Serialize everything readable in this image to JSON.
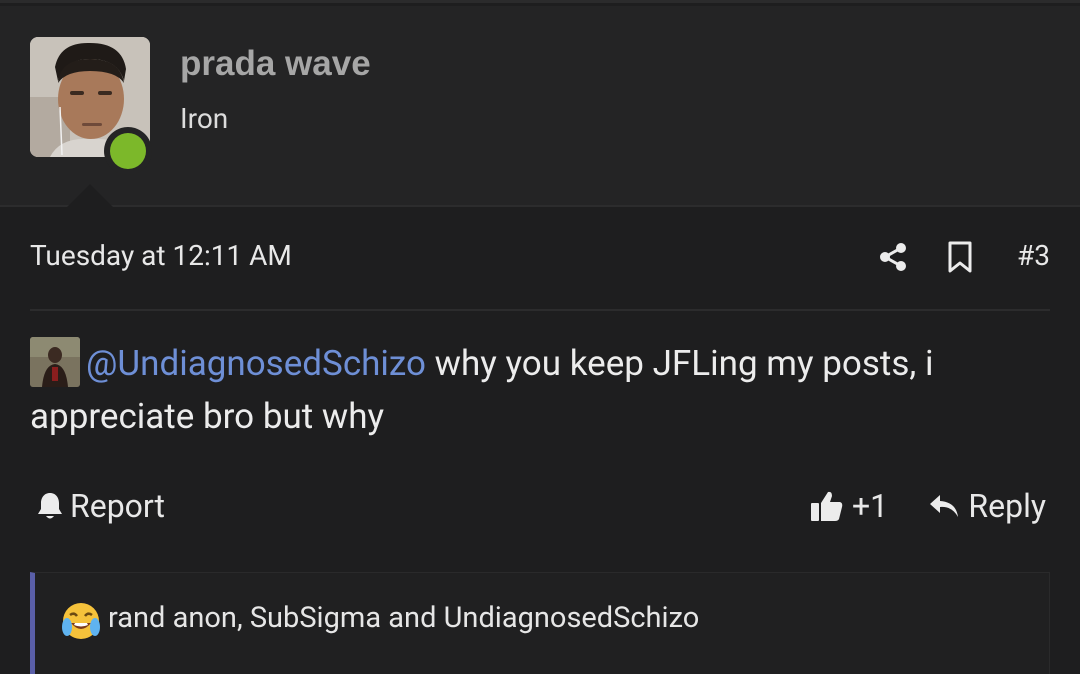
{
  "user": {
    "name": "prada wave",
    "title": "Iron",
    "online": true
  },
  "post": {
    "date": "Tuesday at 12:11 AM",
    "number": "#3",
    "mention": "@UndiagnosedSchizo",
    "body_line1": " why you keep JFLing my posts, i",
    "body_line2": "appreciate bro but why"
  },
  "actions": {
    "report": "Report",
    "likes": "+1",
    "reply": "Reply"
  },
  "reactions": {
    "emoji": "crying-laughing-emoji",
    "users": "rand anon, SubSigma and UndiagnosedSchizo"
  },
  "colors": {
    "background": "#1e1e1f",
    "header": "#242425",
    "online": "#7cb82a",
    "mention": "#6e8fd6",
    "reaction_bar": "#5a5fa8"
  }
}
